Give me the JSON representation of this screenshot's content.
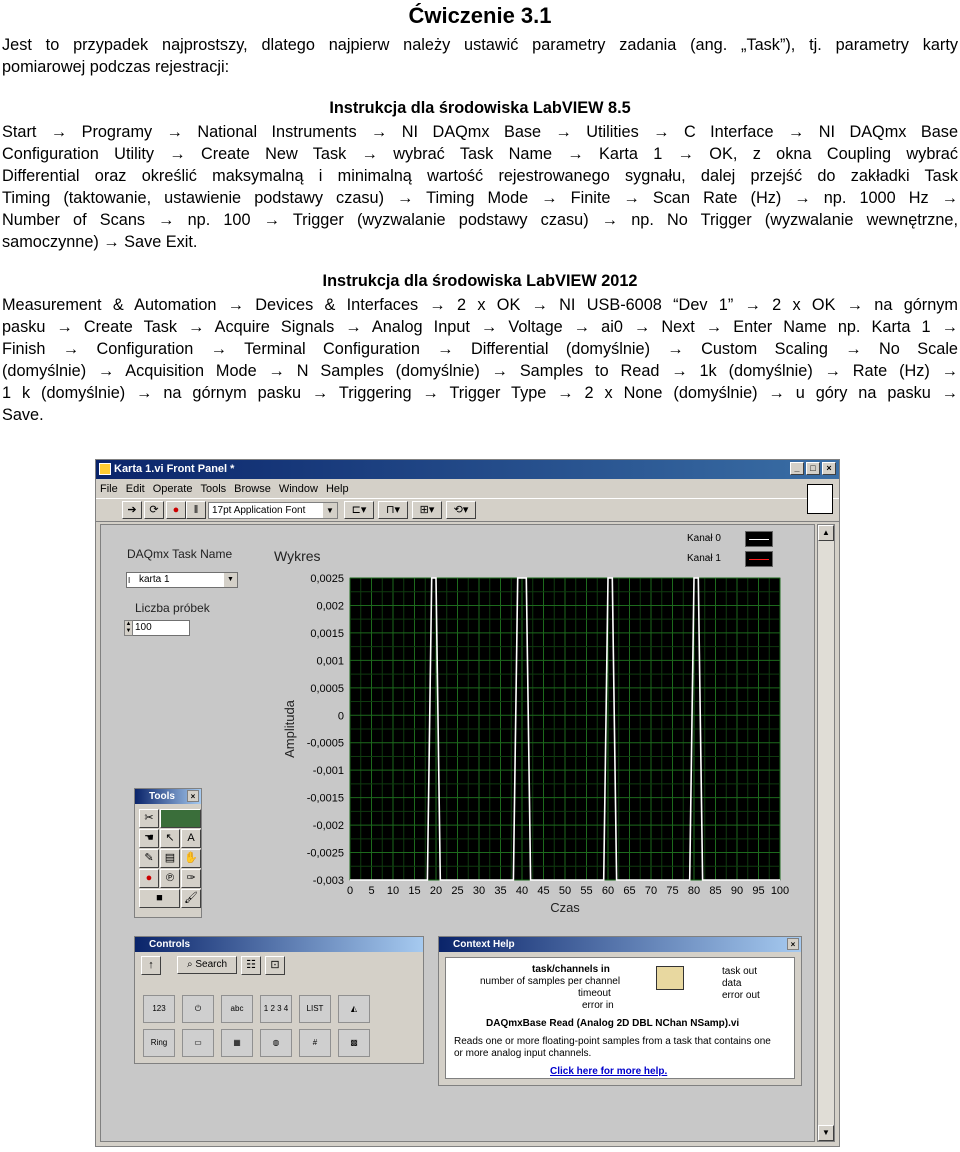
{
  "document": {
    "title": "Ćwiczenie 3.1",
    "intro_lines": [
      "Jest to przypadek najprostszy, dlatego najpierw należy ustawić parametry zadania (ang. „Task”), tj. parametry karty",
      "pomiarowej podczas rejestracji:"
    ],
    "section1": {
      "heading": "Instrukcja dla środowiska LabVIEW 8.5",
      "lines": [
        "Start → Programy → National Instruments → NI DAQmx Base → Utilities → C Interface → NI DAQmx Base",
        "Configuration Utility → Create New Task → wybrać Task Name → Karta 1 → OK, z okna Coupling wybrać",
        "Differential oraz określić maksymalną i minimalną wartość rejestrowanego sygnału, dalej przejść do zakładki Task",
        "Timing (taktowanie, ustawienie podstawy czasu) → Timing Mode → Finite → Scan Rate (Hz) → np. 1000 Hz →",
        "Number of Scans → np. 100 → Trigger (wyzwalanie podstawy czasu) → np. No Trigger (wyzwalanie wewnętrzne,",
        "samoczynne) → Save  Exit."
      ]
    },
    "section2": {
      "heading": "Instrukcja dla środowiska LabVIEW 2012",
      "lines": [
        "Measurement & Automation → Devices & Interfaces → 2 x OK → NI USB-6008 “Dev 1” → 2 x OK → na górnym",
        "pasku → Create Task → Acquire Signals → Analog Input → Voltage → ai0 → Next → Enter Name np. Karta 1 →",
        "Finish → Configuration → Terminal Configuration → Differential (domyślnie) → Custom Scaling → No Scale",
        "(domyślnie) → Acquisition Mode → N Samples (domyślnie) → Samples to Read → 1k (domyślnie) → Rate (Hz) →",
        "1 k (domyślnie) → na górnym pasku → Triggering → Trigger Type → 2 x None (domyślnie) → u góry na pasku →",
        "Save."
      ]
    }
  },
  "window": {
    "title": "Karta 1.vi Front Panel *",
    "menu": [
      "File",
      "Edit",
      "Operate",
      "Tools",
      "Browse",
      "Window",
      "Help"
    ],
    "font_selector": "17pt Application Font"
  },
  "front_panel": {
    "task_label": "DAQmx Task Name",
    "task_value": "karta 1",
    "samples_label": "Liczba próbek",
    "samples_value": "100",
    "graph_title": "Wykres",
    "legend": [
      {
        "name": "Kanał 0",
        "color": "#ffffff"
      },
      {
        "name": "Kanał 1",
        "color": "#ff2020"
      }
    ]
  },
  "chart_data": {
    "type": "line",
    "title": "Wykres",
    "xlabel": "Czas",
    "ylabel": "Amplituda",
    "xlim": [
      0,
      100
    ],
    "ylim": [
      -0.003,
      0.0025
    ],
    "x_ticks": [
      "0",
      "5",
      "10",
      "15",
      "20",
      "25",
      "30",
      "35",
      "40",
      "45",
      "50",
      "55",
      "60",
      "65",
      "70",
      "75",
      "80",
      "85",
      "90",
      "95",
      "100"
    ],
    "y_ticks": [
      "0,0025",
      "0,002",
      "0,0015",
      "0,001",
      "0,0005",
      "0",
      "-0,0005",
      "-0,001",
      "-0,0015",
      "-0,002",
      "-0,0025",
      "-0,003"
    ],
    "grid": true,
    "legend_position": "top-right",
    "series": [
      {
        "name": "Kanał 0",
        "color": "#ffffff",
        "pulses": [
          {
            "rise": 19,
            "fall": 20,
            "level": 0.0025
          },
          {
            "rise": 39,
            "fall": 41,
            "level": 0.0025
          },
          {
            "rise": 60,
            "fall": 61,
            "level": 0.0025
          },
          {
            "rise": 80,
            "fall": 81,
            "level": 0.0025
          }
        ],
        "baseline": -0.003
      }
    ]
  },
  "tools_palette": {
    "title": "Tools"
  },
  "controls_palette": {
    "title": "Controls",
    "search_label": "Search",
    "items": [
      "123",
      "",
      "abc Path",
      "1 2 3 4",
      "LIST",
      "",
      "Ring",
      "",
      "",
      "",
      "#",
      "",
      "",
      "",
      "",
      "",
      "",
      ""
    ]
  },
  "context_help": {
    "title": "Context Help",
    "inputs": [
      "task/channels in",
      "number of samples per channel",
      "timeout",
      "error in"
    ],
    "outputs": [
      "task out",
      "data",
      "error out"
    ],
    "function_name": "DAQmxBase Read (Analog 2D DBL NChan NSamp).vi",
    "description_lines": [
      "Reads one or more floating-point samples from a task that contains one",
      "or more analog input channels."
    ],
    "link": "Click here for more help."
  }
}
